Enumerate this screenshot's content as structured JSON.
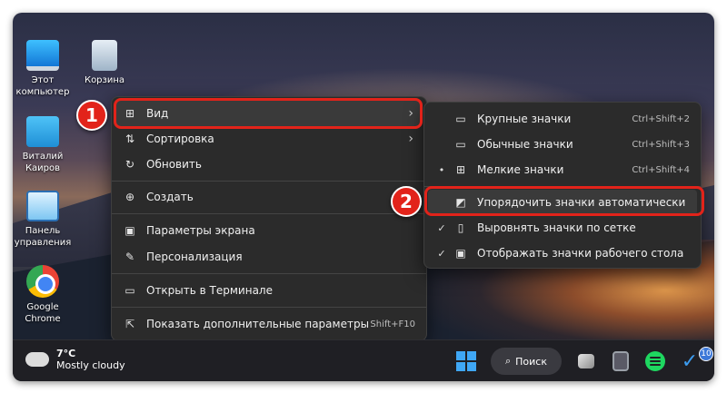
{
  "desktop": {
    "icons": [
      {
        "label": "Этот компьютер",
        "icon": "computer-icon"
      },
      {
        "label": "Корзина",
        "icon": "recycle-bin-icon"
      },
      {
        "label": "Виталий Каиров",
        "icon": "user-folder-icon"
      },
      {
        "label": "Панель управления",
        "icon": "control-panel-icon"
      },
      {
        "label": "Google Chrome",
        "icon": "chrome-icon"
      }
    ]
  },
  "context_menu": {
    "items": [
      {
        "label": "Вид",
        "icon": "grid-icon",
        "has_submenu": true
      },
      {
        "label": "Сортировка",
        "icon": "sort-icon",
        "has_submenu": true
      },
      {
        "label": "Обновить",
        "icon": "refresh-icon"
      },
      {
        "label": "Создать",
        "icon": "plus-circle-icon",
        "has_submenu": true
      },
      {
        "label": "Параметры экрана",
        "icon": "display-icon"
      },
      {
        "label": "Персонализация",
        "icon": "brush-icon"
      },
      {
        "label": "Открыть в Терминале",
        "icon": "terminal-icon"
      },
      {
        "label": "Показать дополнительные параметры",
        "icon": "share-icon",
        "shortcut": "Shift+F10"
      }
    ]
  },
  "view_submenu": {
    "items": [
      {
        "label": "Крупные значки",
        "shortcut": "Ctrl+Shift+2",
        "mark": ""
      },
      {
        "label": "Обычные значки",
        "shortcut": "Ctrl+Shift+3",
        "mark": ""
      },
      {
        "label": "Мелкие значки",
        "shortcut": "Ctrl+Shift+4",
        "mark": "•"
      },
      {
        "label": "Упорядочить значки автоматически",
        "shortcut": "",
        "mark": ""
      },
      {
        "label": "Выровнять значки по сетке",
        "shortcut": "",
        "mark": "✓"
      },
      {
        "label": "Отображать значки рабочего стола",
        "shortcut": "",
        "mark": "✓"
      }
    ]
  },
  "callouts": {
    "one": "1",
    "two": "2"
  },
  "taskbar": {
    "temperature": "7°C",
    "weather": "Mostly cloudy",
    "search_label": "Поиск",
    "badge_count": "10"
  },
  "colors": {
    "callout": "#e2231a",
    "menu_bg": "#2b2b2b"
  }
}
